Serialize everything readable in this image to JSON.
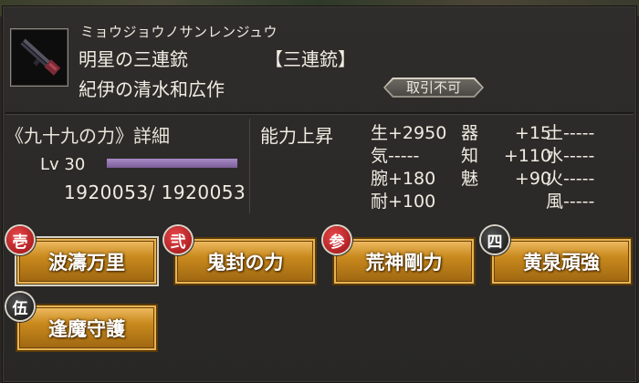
{
  "item": {
    "kana": "ミョウジョウノサンレンジュウ",
    "name": "明星の三連銃",
    "type": "【三連銃】",
    "maker": "紀伊の清水和広作",
    "trade_status": "取引不可"
  },
  "detail": {
    "title": "《九十九の力》詳細",
    "level_label": "Lv 30",
    "level_progress": 1.0,
    "experience": "1920053/ 1920053"
  },
  "ability": {
    "title": "能力上昇",
    "columns": [
      [
        {
          "label": "生",
          "value": "+2950"
        },
        {
          "label": "気",
          "value": "-----"
        },
        {
          "label": "腕",
          "value": "+180"
        },
        {
          "label": "耐",
          "value": "+100"
        }
      ],
      [
        {
          "label": "器",
          "value": "+15"
        },
        {
          "label": "知",
          "value": "+110"
        },
        {
          "label": "魅",
          "value": "+90"
        }
      ],
      [
        {
          "label": "土",
          "value": "-----"
        },
        {
          "label": "水",
          "value": "-----"
        },
        {
          "label": "火",
          "value": "-----"
        },
        {
          "label": "風",
          "value": "-----"
        }
      ]
    ]
  },
  "skills": [
    {
      "badge": "壱",
      "label": "波濤万里",
      "badge_color": "#c21a1e"
    },
    {
      "badge": "弐",
      "label": "鬼封の力",
      "badge_color": "#c21a1e"
    },
    {
      "badge": "参",
      "label": "荒神剛力",
      "badge_color": "#c21a1e"
    },
    {
      "badge": "四",
      "label": "黄泉頑強",
      "badge_color": "#1a1a1a"
    },
    {
      "badge": "伍",
      "label": "逢魔守護",
      "badge_color": "#1a1a1a"
    }
  ]
}
